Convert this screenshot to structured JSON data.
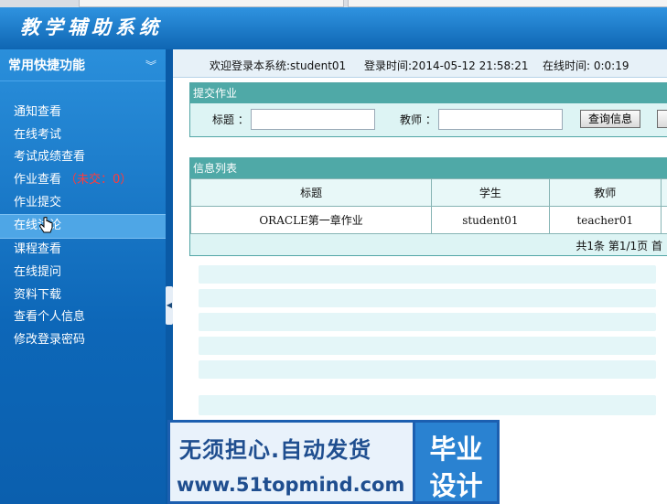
{
  "app": {
    "title": "教学辅助系统"
  },
  "sidebar": {
    "title": "常用快捷功能",
    "collapse_icon": "double-chevron-down-icon",
    "items": [
      {
        "label": "通知查看"
      },
      {
        "label": "在线考试"
      },
      {
        "label": "考试成绩查看"
      },
      {
        "label": "作业查看",
        "extra": "（未交：0）"
      },
      {
        "label": "作业提交"
      },
      {
        "label": "在线讨论"
      },
      {
        "label": "课程查看"
      },
      {
        "label": "在线提问"
      },
      {
        "label": "资料下载"
      },
      {
        "label": "查看个人信息"
      },
      {
        "label": "修改登录密码"
      }
    ]
  },
  "statusbar": {
    "welcome": "欢迎登录本系统:student01",
    "login_time": "登录时间:2014-05-12 21:58:21",
    "online_time": "在线时间: 0:0:19"
  },
  "submit_panel": {
    "title": "提交作业",
    "title_label": "标题 ：",
    "title_value": "",
    "teacher_label": "教师 ：",
    "teacher_value": "",
    "query_button": "查询信息"
  },
  "list_panel": {
    "title": "信息列表",
    "columns": [
      "标题",
      "学生",
      "教师"
    ],
    "rows": [
      {
        "title": "ORACLE第一章作业",
        "student": "student01",
        "teacher": "teacher01"
      }
    ],
    "pager": "共1条  第1/1页  首"
  },
  "banner": {
    "line1": "无须担心.自动发货",
    "line2": "www.51topmind.com",
    "right1": "毕业",
    "right2": "设计"
  },
  "colors": {
    "header": "#1769b8",
    "panel_header": "#4fa9a7",
    "panel_bg": "#ddf4f4",
    "alert": "#ff3b3b"
  }
}
